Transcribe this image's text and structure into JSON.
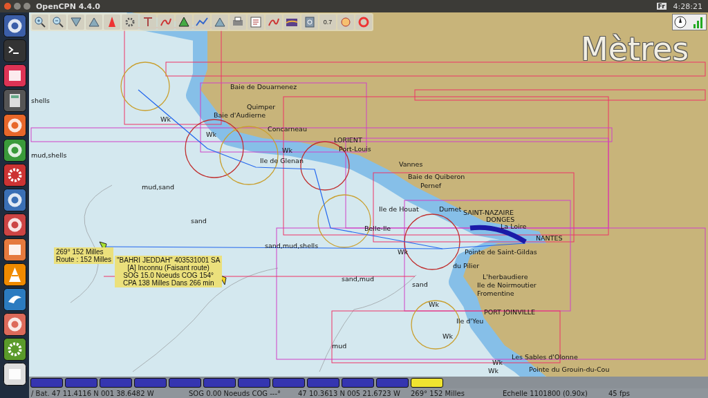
{
  "window": {
    "title": "OpenCPN 4.4.0"
  },
  "top_panel": {
    "indicator": "Fr",
    "clock": "4:28:21"
  },
  "launcher": [
    {
      "kind": "dash"
    },
    {
      "kind": "terminal"
    },
    {
      "kind": "files"
    },
    {
      "kind": "calculator"
    },
    {
      "kind": "browser"
    },
    {
      "kind": "globe"
    },
    {
      "kind": "settings"
    },
    {
      "kind": "torrent"
    },
    {
      "kind": "tool"
    },
    {
      "kind": "software"
    },
    {
      "kind": "cone"
    },
    {
      "kind": "dolphin"
    },
    {
      "kind": "paint"
    },
    {
      "kind": "system"
    },
    {
      "kind": "chart"
    }
  ],
  "toolbar": [
    {
      "kind": "zoom-in"
    },
    {
      "kind": "zoom-out"
    },
    {
      "kind": "down"
    },
    {
      "kind": "up"
    },
    {
      "kind": "ship"
    },
    {
      "kind": "settings"
    },
    {
      "kind": "text"
    },
    {
      "kind": "route"
    },
    {
      "kind": "ais"
    },
    {
      "kind": "track"
    },
    {
      "kind": "up"
    },
    {
      "kind": "print"
    },
    {
      "kind": "list"
    },
    {
      "kind": "route"
    },
    {
      "kind": "landscape"
    },
    {
      "kind": "help"
    },
    {
      "kind": "zoom-level",
      "label": "0.7"
    },
    {
      "kind": "color"
    },
    {
      "kind": "lifebuoy"
    }
  ],
  "chart": {
    "unit_label": "Mètres",
    "places": [
      "Baie de Douarnenez",
      "Quimper",
      "Baie d'Audierne",
      "Concarneau",
      "Ile de Glenan",
      "LORIENT",
      "Port-Louis",
      "Vannes",
      "Baie de Quiberon",
      "Pernef",
      "Ile de Houat",
      "Dumet",
      "SAINT-NAZAIRE",
      "DONGES",
      "La Loire",
      "NANTES",
      "Belle-Ile",
      "Pointe de Saint-Gildas",
      "du Pilier",
      "L'herbaudiere",
      "Ile de Noirmoutier",
      "Fromentine",
      "PORT JOINVILLE",
      "Ile d'Yeu",
      "Les Sables d'Olonne",
      "Pointe du Grouin-du-Cou"
    ],
    "seabed": [
      "shells",
      "mud,shells",
      "mud,sand",
      "sand",
      "sand,mud,shells",
      "sand,mud",
      "sand",
      "mud"
    ],
    "wrecks": [
      "Wk",
      "Wk",
      "Wk",
      "Wk",
      "Wk",
      "Wk",
      "Wk",
      "Wk"
    ],
    "route_tooltip": [
      "269°  152 Milles",
      "Route : 152 Milles"
    ],
    "ais_tooltip": [
      "\"BAHRI JEDDAH\" 403531001 SA",
      "[A] Inconnu (Faisant route)",
      "SOG 15.0 Noeuds COG 154°",
      "CPA 138 Milles Dans 266 min"
    ]
  },
  "chart_bar": [
    {
      "selected": false
    },
    {
      "selected": false
    },
    {
      "selected": false
    },
    {
      "selected": false
    },
    {
      "selected": false
    },
    {
      "selected": false
    },
    {
      "selected": false
    },
    {
      "selected": false
    },
    {
      "selected": false
    },
    {
      "selected": false
    },
    {
      "selected": false
    },
    {
      "selected": true
    }
  ],
  "status_bar": [
    "/ Bat. 47 11.4116 N   001 38.6482 W",
    "SOG 0.00 Noeuds  COG ---°",
    "47 10.3613 N   005 21.6723 W",
    "269°  152 Milles",
    "Echelle 1101800 (0.90x)",
    "45 fps"
  ]
}
